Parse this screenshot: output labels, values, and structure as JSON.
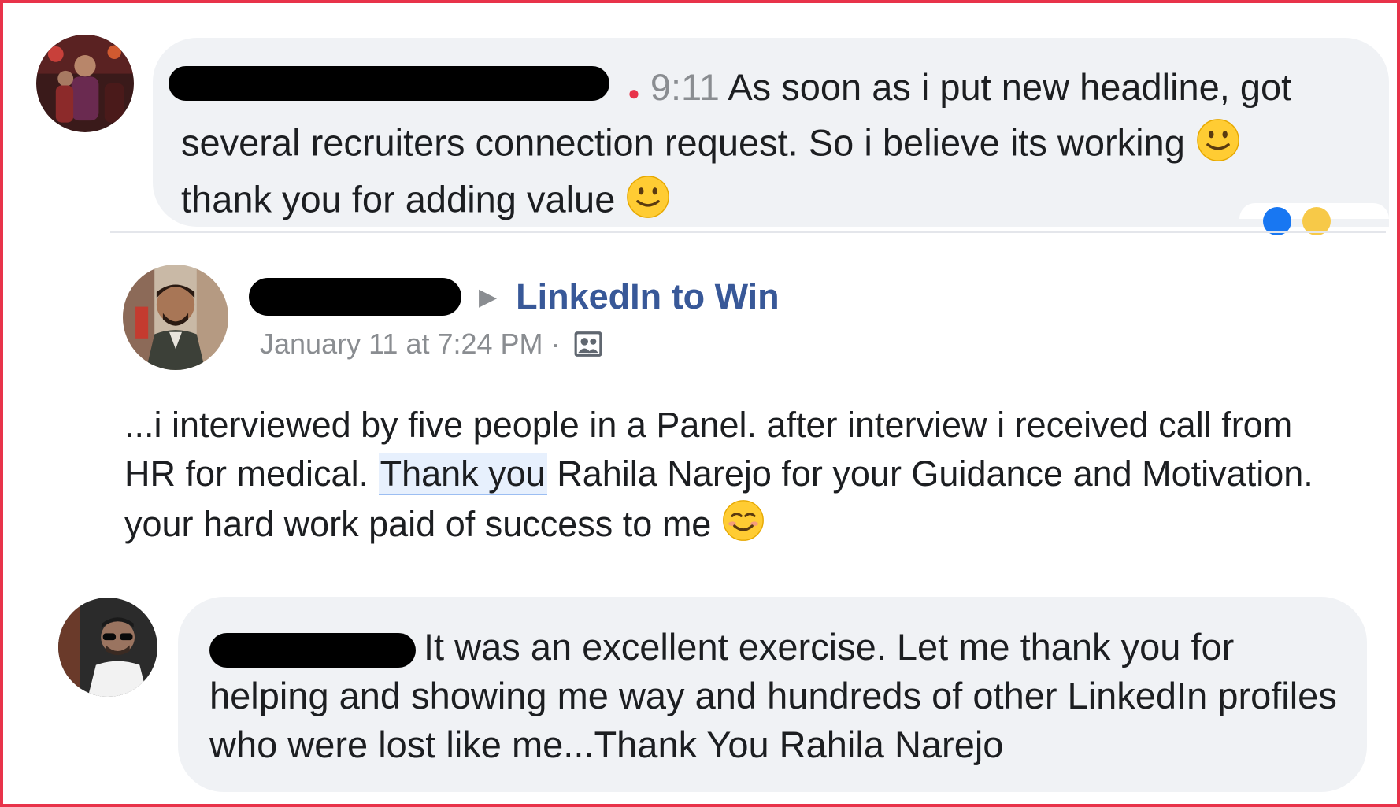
{
  "comment_1": {
    "time": "9:11",
    "text": "As soon as i put new headline, got several recruiters connection request. So i believe its working",
    "text_2": "thank you for adding value",
    "emoji_1": "slightly-smiling-face",
    "emoji_2": "slightly-smiling-face"
  },
  "post": {
    "arrow": "▶",
    "group_name": "LinkedIn to Win",
    "date": "January 11 at 7:24 PM",
    "separator": "·",
    "privacy_icon": "group-icon",
    "body_before": "...i interviewed by five people in a Panel. after interview i received call from HR for medical.",
    "body_highlight": "Thank you",
    "body_after": "Rahila Narejo for your Guidance and Motivation. your hard work paid of success to me",
    "emoji": "smiling-face-with-smiling-eyes"
  },
  "comment_2": {
    "text": "It was an excellent exercise. Let me thank you for helping and showing me way and hundreds of other LinkedIn profiles who were lost like me...Thank You Rahila Narejo"
  },
  "colors": {
    "frame_border": "#e8334a",
    "bubble_bg": "#f0f2f5",
    "link_blue": "#385898",
    "meta_gray": "#8a8d91"
  }
}
